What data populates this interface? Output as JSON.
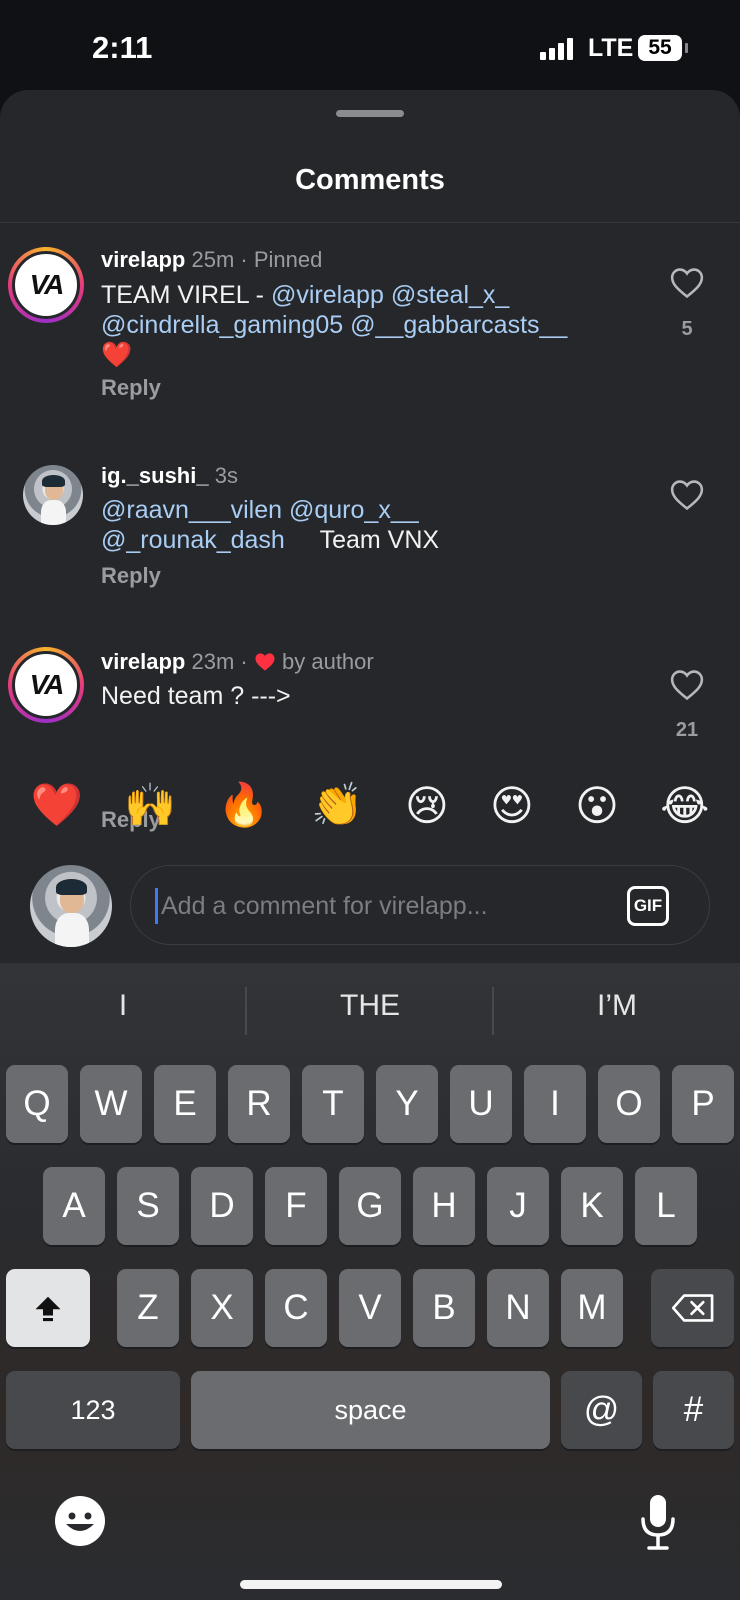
{
  "status": {
    "time": "2:11",
    "network": "LTE",
    "battery": "55"
  },
  "sheet": {
    "title": "Comments"
  },
  "comments": [
    {
      "user": "virelapp",
      "meta": "25m · Pinned",
      "text_plain": "TEAM VIREL - ",
      "mentions": [
        "@virelapp",
        "@steal_x_",
        "@cindrella_gaming05",
        "@__gabbarcasts__"
      ],
      "emoji": "❤️",
      "reply": "Reply",
      "likes": "5"
    },
    {
      "user": "ig._sushi_",
      "meta": "3s",
      "mentions": [
        "@raavn___vilen",
        "@quro_x__",
        "@_rounak_dash"
      ],
      "text_tail": "Team VNX",
      "reply": "Reply",
      "likes": ""
    },
    {
      "user": "virelapp",
      "meta_time": "23m ·",
      "meta_liked": "by author",
      "text": "Need team ? --->",
      "reply": "Reply",
      "likes": "21"
    }
  ],
  "avatar_text": "VA",
  "emoji_bar": [
    "❤️",
    "🙌",
    "🔥",
    "👏",
    "😢",
    "😍",
    "😮",
    "😂"
  ],
  "composer": {
    "placeholder": "Add a comment for virelapp...",
    "gif_label": "GIF"
  },
  "keyboard": {
    "suggestions": [
      "I",
      "THE",
      "I’M"
    ],
    "row1": [
      "Q",
      "W",
      "E",
      "R",
      "T",
      "Y",
      "U",
      "I",
      "O",
      "P"
    ],
    "row2": [
      "A",
      "S",
      "D",
      "F",
      "G",
      "H",
      "J",
      "K",
      "L"
    ],
    "row3": [
      "Z",
      "X",
      "C",
      "V",
      "B",
      "N",
      "M"
    ],
    "numbers_label": "123",
    "space_label": "space",
    "at_label": "@",
    "hash_label": "#"
  }
}
